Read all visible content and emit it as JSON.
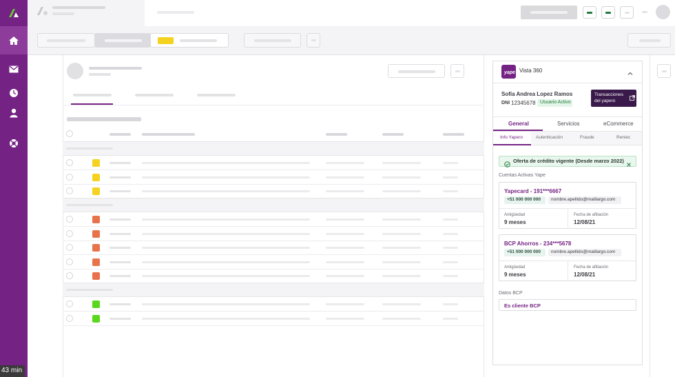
{
  "taskbar": {
    "clock_label": "43 min"
  },
  "panel": {
    "title": "Vista 360",
    "user_name": "Sofía Andrea Lopez Ramos",
    "dni_label": "DNI",
    "dni_value": "12345678",
    "status_badge": "Usuario Activo",
    "transactions_button": [
      "Transacciones",
      "del yapero"
    ],
    "tabs": [
      "General",
      "Servicios",
      "eCommerce"
    ],
    "subtabs": [
      "Info Yapero",
      "Autenticación",
      "Fraude",
      "Reniec"
    ],
    "credit_banner": "Oferta de crédito vigente (Desde marzo 2022)",
    "accounts_section_label": "Cuentas Activas Yape",
    "accounts": [
      {
        "title": "Yapecard - 191***6667",
        "phone": "+51 000 000 000",
        "email": "nombre.apellido@maillargo.com",
        "age_label": "Antigüedad",
        "age_value": "9 meses",
        "date_label": "Fecha de afiliación",
        "date_value": "12/08/21"
      },
      {
        "title": "BCP Ahorros - 234***5678",
        "phone": "+51 000 000 000",
        "email": "nombre.apellido@maillargo.com",
        "age_label": "Antigüedad",
        "age_value": "9 meses",
        "date_label": "Fecha de afiliación",
        "date_value": "12/08/21"
      }
    ],
    "bcp_section_label": "Datos BCP",
    "bcp_value": "Es cliente BCP"
  },
  "colors": {
    "sidebar": "#742284",
    "brand_purple": "#742284",
    "status_yellow": "#f5d21f",
    "status_orange": "#e8734b",
    "status_green": "#59d81c",
    "accent_green": "#1f7a3a"
  },
  "icons": [
    "logo-icon",
    "home-icon",
    "mail-icon",
    "clock-icon",
    "user-icon",
    "support-icon",
    "chevron-up-icon",
    "external-link-icon",
    "check-circle-icon",
    "close-icon"
  ]
}
